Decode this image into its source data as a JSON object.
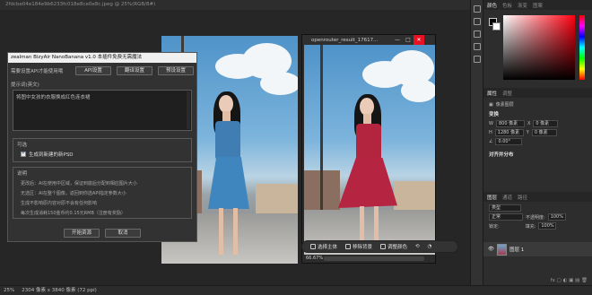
{
  "document": {
    "tab_title": "2fdcbe04e184e9b6233fc018e8ce0e8c.jpeg @ 25%(RGB/8#)"
  },
  "preview_window": {
    "title": "openrouter_result_17617...",
    "zoom": "66.67%",
    "buttons": {
      "minimize": "—",
      "maximize": "□",
      "close": "✕"
    }
  },
  "context_bar": {
    "items": [
      "选择主体",
      "移除背景",
      "调整颜色"
    ]
  },
  "plugin": {
    "title": "zealman BizyAir NanoBanana v1.0 本插件免费无需魔法",
    "api_hint": "需要设置API才能使用哦",
    "buttons": {
      "api": "API设置",
      "translate": "翻译设置",
      "preset": "预设设置"
    },
    "prompt_label": "提示词(英文)",
    "prompt_text": "将图中女孩的衣服换成红色连衣裙",
    "options_label": "可选",
    "generate_psd_label": "生成到新建的新PSD",
    "notes_label": "说明",
    "notes": [
      "更改后：AI在使用中区域，保证到底后分配到相应图片大小",
      "无选区：AI在整个图像，返回到你选API指定参数大小",
      "生成不影响原内容对原不会有任何影响",
      "每次生成消耗150金币约0.15元RMB（注册有奖励）"
    ],
    "start_button": "开始资源",
    "cancel_button": "取消"
  },
  "right_panel": {
    "color_tabs": [
      "颜色",
      "色板",
      "渐变",
      "图案"
    ],
    "properties_tabs": [
      "属性",
      "调整"
    ],
    "pixel_layer_label": "像素图层",
    "transform_label": "变换",
    "w_label": "W",
    "w_value": "800 像素",
    "h_label": "H",
    "h_value": "1280 像素",
    "x_label": "X",
    "x_value": "0 像素",
    "y_label": "Y",
    "y_value": "0 像素",
    "angle_value": "0.00°",
    "align_label": "对齐并分布",
    "layers_tabs": [
      "图层",
      "通道",
      "路径"
    ],
    "kind_filter": "类型",
    "blend_mode": "正常",
    "opacity_label": "不透明度:",
    "opacity_value": "100%",
    "lock_label": "锁定:",
    "fill_label": "填充:",
    "fill_value": "100%",
    "layer_name": "图层 1",
    "footer_icons": "fx  ▢  ◐  ▣  ▤  🗑"
  },
  "statusbar": {
    "zoom": "25%",
    "doc_info": "2304 像素 x 3840 像素 (72 ppi)"
  }
}
